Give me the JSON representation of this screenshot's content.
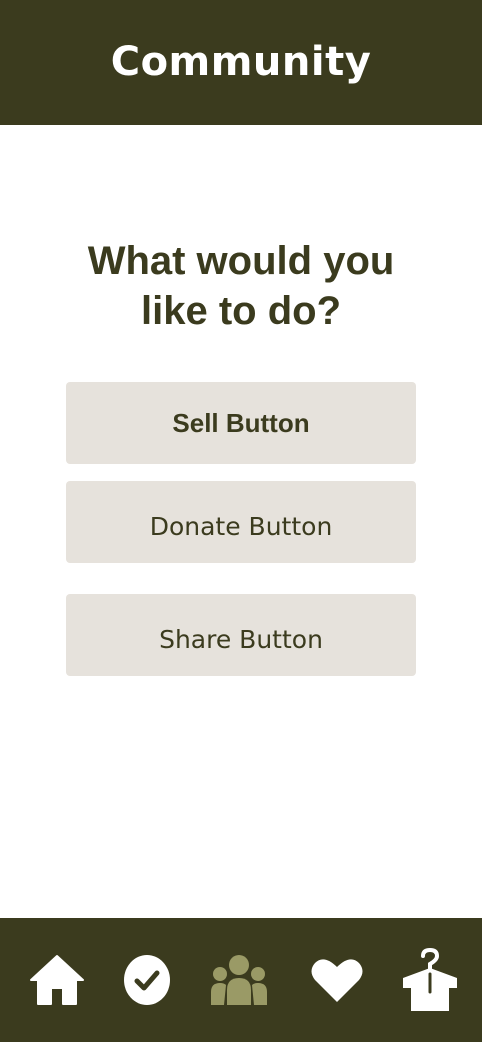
{
  "header": {
    "title": "Community"
  },
  "prompt": {
    "line1": "What would you",
    "line2": "like to do?"
  },
  "actions": {
    "sell_label": "Sell Button",
    "donate_label": "Donate Button",
    "share_label": "Share Button"
  },
  "nav": {
    "items": [
      {
        "icon": "home-icon",
        "active": false
      },
      {
        "icon": "check-circle-icon",
        "active": false
      },
      {
        "icon": "community-icon",
        "active": true
      },
      {
        "icon": "heart-icon",
        "active": false
      },
      {
        "icon": "shirt-hanger-icon",
        "active": false
      }
    ]
  },
  "colors": {
    "primary_dark": "#3b3b1e",
    "button_bg": "#e6e2dc",
    "active_icon": "#9a9a66",
    "inactive_icon": "#ffffff",
    "background": "#ffffff"
  }
}
